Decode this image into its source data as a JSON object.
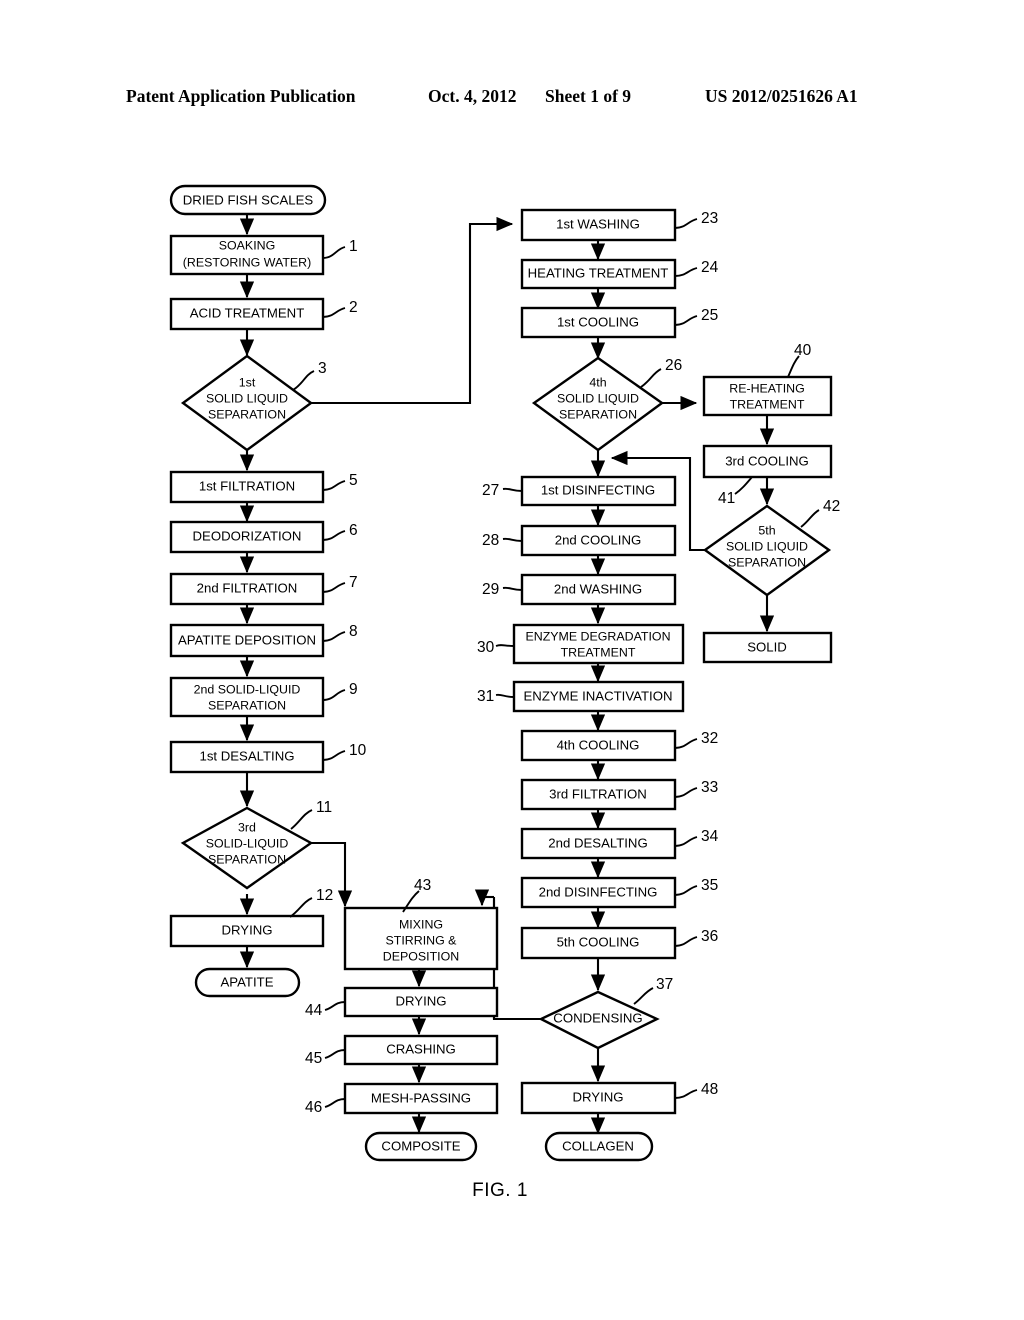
{
  "header": {
    "publication": "Patent Application Publication",
    "date": "Oct. 4, 2012",
    "sheet": "Sheet 1 of 9",
    "number": "US 2012/0251626 A1"
  },
  "figure": {
    "caption": "FIG. 1"
  },
  "chart_data": {
    "type": "diagram",
    "title": "FIG. 1",
    "subtype": "process-flowchart",
    "nodes": [
      {
        "id": "start_left",
        "shape": "terminator",
        "label": "DRIED FISH SCALES",
        "ref": "",
        "column": "left"
      },
      {
        "id": "n1",
        "shape": "process",
        "label": "SOAKING\n(RESTORING WATER)",
        "ref": "1",
        "column": "left"
      },
      {
        "id": "n2",
        "shape": "process",
        "label": "ACID TREATMENT",
        "ref": "2",
        "column": "left"
      },
      {
        "id": "n3",
        "shape": "decision",
        "label": "1st\nSOLID LIQUID\nSEPARATION",
        "ref": "3",
        "column": "left"
      },
      {
        "id": "n5",
        "shape": "process",
        "label": "1st FILTRATION",
        "ref": "5",
        "column": "left"
      },
      {
        "id": "n6",
        "shape": "process",
        "label": "DEODORIZATION",
        "ref": "6",
        "column": "left"
      },
      {
        "id": "n7",
        "shape": "process",
        "label": "2nd FILTRATION",
        "ref": "7",
        "column": "left"
      },
      {
        "id": "n8",
        "shape": "process",
        "label": "APATITE DEPOSITION",
        "ref": "8",
        "column": "left"
      },
      {
        "id": "n9",
        "shape": "process",
        "label": "2nd SOLID-LIQUID\nSEPARATION",
        "ref": "9",
        "column": "left"
      },
      {
        "id": "n10",
        "shape": "process",
        "label": "1st DESALTING",
        "ref": "10",
        "column": "left"
      },
      {
        "id": "n11",
        "shape": "decision",
        "label": "3rd\nSOLID-LIQUID\nSEPARATION",
        "ref": "11",
        "column": "left"
      },
      {
        "id": "n12",
        "shape": "process",
        "label": "DRYING",
        "ref": "12",
        "column": "left"
      },
      {
        "id": "end_apatite",
        "shape": "terminator",
        "label": "APATITE",
        "ref": "",
        "column": "left"
      },
      {
        "id": "n43",
        "shape": "process",
        "label": "MIXING\nSTIRRING &\nDEPOSITION",
        "ref": "43",
        "column": "center"
      },
      {
        "id": "n44",
        "shape": "process",
        "label": "DRYING",
        "ref": "44",
        "column": "center"
      },
      {
        "id": "n45",
        "shape": "process",
        "label": "CRASHING",
        "ref": "45",
        "column": "center"
      },
      {
        "id": "n46",
        "shape": "process",
        "label": "MESH-PASSING",
        "ref": "46",
        "column": "center"
      },
      {
        "id": "end_composite",
        "shape": "terminator",
        "label": "COMPOSITE",
        "ref": "",
        "column": "center"
      },
      {
        "id": "n23",
        "shape": "process",
        "label": "1st WASHING",
        "ref": "23",
        "column": "right"
      },
      {
        "id": "n24",
        "shape": "process",
        "label": "HEATING TREATMENT",
        "ref": "24",
        "column": "right"
      },
      {
        "id": "n25",
        "shape": "process",
        "label": "1st COOLING",
        "ref": "25",
        "column": "right"
      },
      {
        "id": "n26",
        "shape": "decision",
        "label": "4th\nSOLID LIQUID\nSEPARATION",
        "ref": "26",
        "column": "right"
      },
      {
        "id": "n27",
        "shape": "process",
        "label": "1st DISINFECTING",
        "ref": "27",
        "column": "right"
      },
      {
        "id": "n28",
        "shape": "process",
        "label": "2nd COOLING",
        "ref": "28",
        "column": "right"
      },
      {
        "id": "n29",
        "shape": "process",
        "label": "2nd WASHING",
        "ref": "29",
        "column": "right"
      },
      {
        "id": "n30",
        "shape": "process",
        "label": "ENZYME DEGRADATION\nTREATMENT",
        "ref": "30",
        "column": "right"
      },
      {
        "id": "n31",
        "shape": "process",
        "label": "ENZYME INACTIVATION",
        "ref": "31",
        "column": "right"
      },
      {
        "id": "n32",
        "shape": "process",
        "label": "4th COOLING",
        "ref": "32",
        "column": "right"
      },
      {
        "id": "n33",
        "shape": "process",
        "label": "3rd FILTRATION",
        "ref": "33",
        "column": "right"
      },
      {
        "id": "n34",
        "shape": "process",
        "label": "2nd DESALTING",
        "ref": "34",
        "column": "right"
      },
      {
        "id": "n35",
        "shape": "process",
        "label": "2nd DISINFECTING",
        "ref": "35",
        "column": "right"
      },
      {
        "id": "n36",
        "shape": "process",
        "label": "5th COOLING",
        "ref": "36",
        "column": "right"
      },
      {
        "id": "n37",
        "shape": "decision",
        "label": "CONDENSING",
        "ref": "37",
        "column": "right"
      },
      {
        "id": "n48",
        "shape": "process",
        "label": "DRYING",
        "ref": "48",
        "column": "right"
      },
      {
        "id": "end_collagen",
        "shape": "terminator",
        "label": "COLLAGEN",
        "ref": "",
        "column": "right"
      },
      {
        "id": "n40",
        "shape": "process",
        "label": "RE-HEATING\nTREATMENT",
        "ref": "40",
        "column": "far-right"
      },
      {
        "id": "n41",
        "shape": "process",
        "label": "3rd COOLING",
        "ref": "41",
        "column": "far-right"
      },
      {
        "id": "n42",
        "shape": "decision",
        "label": "5th\nSOLID LIQUID\nSEPARATION",
        "ref": "42",
        "column": "far-right"
      },
      {
        "id": "end_solid",
        "shape": "process",
        "label": "SOLID",
        "ref": "",
        "column": "far-right"
      }
    ],
    "edges": [
      {
        "from": "start_left",
        "to": "n1"
      },
      {
        "from": "n1",
        "to": "n2"
      },
      {
        "from": "n2",
        "to": "n3"
      },
      {
        "from": "n3",
        "to": "n5"
      },
      {
        "from": "n3",
        "to": "n23",
        "route": "right-up"
      },
      {
        "from": "n5",
        "to": "n6"
      },
      {
        "from": "n6",
        "to": "n7"
      },
      {
        "from": "n7",
        "to": "n8"
      },
      {
        "from": "n8",
        "to": "n9"
      },
      {
        "from": "n9",
        "to": "n10"
      },
      {
        "from": "n10",
        "to": "n11"
      },
      {
        "from": "n11",
        "to": "n12"
      },
      {
        "from": "n11",
        "to": "n43",
        "route": "right-down"
      },
      {
        "from": "n12",
        "to": "end_apatite"
      },
      {
        "from": "n43",
        "to": "n44"
      },
      {
        "from": "n44",
        "to": "n45"
      },
      {
        "from": "n45",
        "to": "n46"
      },
      {
        "from": "n46",
        "to": "end_composite"
      },
      {
        "from": "n23",
        "to": "n24"
      },
      {
        "from": "n24",
        "to": "n25"
      },
      {
        "from": "n25",
        "to": "n26"
      },
      {
        "from": "n26",
        "to": "n27"
      },
      {
        "from": "n26",
        "to": "n40",
        "route": "right"
      },
      {
        "from": "n27",
        "to": "n28"
      },
      {
        "from": "n28",
        "to": "n29"
      },
      {
        "from": "n29",
        "to": "n30"
      },
      {
        "from": "n30",
        "to": "n31"
      },
      {
        "from": "n31",
        "to": "n32"
      },
      {
        "from": "n32",
        "to": "n33"
      },
      {
        "from": "n33",
        "to": "n34"
      },
      {
        "from": "n34",
        "to": "n35"
      },
      {
        "from": "n35",
        "to": "n36"
      },
      {
        "from": "n36",
        "to": "n37"
      },
      {
        "from": "n37",
        "to": "n48"
      },
      {
        "from": "n48",
        "to": "end_collagen"
      },
      {
        "from": "n37",
        "to": "n43",
        "route": "left-up"
      },
      {
        "from": "n40",
        "to": "n41"
      },
      {
        "from": "n41",
        "to": "n42"
      },
      {
        "from": "n42",
        "to": "end_solid"
      },
      {
        "from": "n42",
        "to": "n27",
        "route": "left-up"
      }
    ]
  }
}
